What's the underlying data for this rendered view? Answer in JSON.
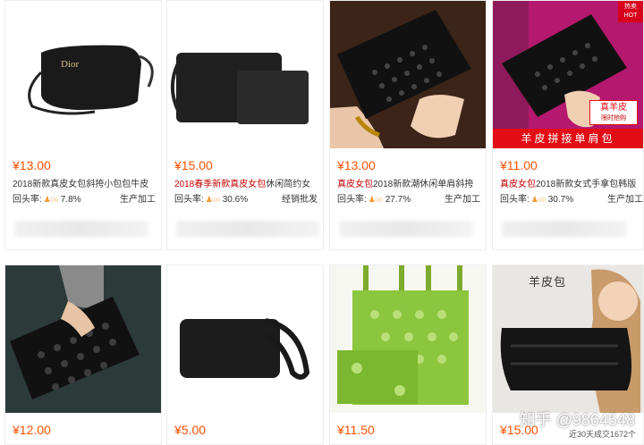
{
  "products": [
    {
      "price": "¥13.00",
      "title_hl": "2018新款真皮女包",
      "title_rest": "斜挎小包包牛皮",
      "rate_label": "回头率:",
      "rate_value": "7.8%",
      "type": "生产加工",
      "logo": "Dior"
    },
    {
      "price": "¥15.00",
      "title_hl": "2018春季新款真皮女包",
      "title_rest": "休闲简约女",
      "rate_label": "回头率:",
      "rate_value": "30.6%",
      "type": "经销批发"
    },
    {
      "price": "¥13.00",
      "title_hl": "真皮女包",
      "title_rest": "2018新款潮休闲单肩斜挎",
      "rate_label": "回头率:",
      "rate_value": "27.7%",
      "type": "生产加工"
    },
    {
      "price": "¥11.00",
      "title_hl": "真皮女包",
      "title_rest": "2018新款女式手拿包韩版",
      "rate_label": "回头率:",
      "rate_value": "30.7%",
      "type": "生产加工",
      "hot": "热卖 HOT",
      "badge": "真羊皮",
      "badge_sub": "限时抢购",
      "banner": "羊皮拼接单肩包"
    },
    {
      "price": "¥12.00"
    },
    {
      "price": "¥5.00"
    },
    {
      "price": "¥11.50"
    },
    {
      "price": "¥15.00",
      "overlay": "羊皮包",
      "watermark": "知乎 @9864548",
      "sold": "近30天成交1672个"
    }
  ],
  "colors": {
    "price": "#ff5000",
    "highlight": "#c40000",
    "banner": "#e30d16"
  }
}
